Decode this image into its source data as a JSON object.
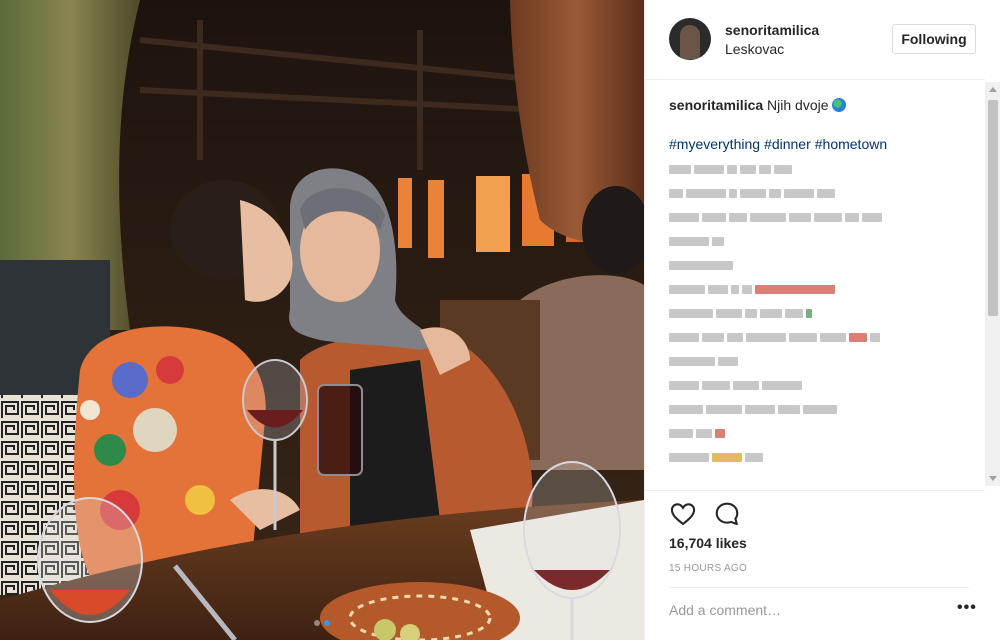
{
  "header": {
    "username": "senoritamilica",
    "location": "Leskovac",
    "follow_label": "Following"
  },
  "caption": {
    "username": "senoritamilica",
    "text": "Njih dvoje",
    "hashtags": [
      "#myeverything",
      "#dinner",
      "#hometown"
    ]
  },
  "blurred_comment_lines": [
    [
      22,
      30,
      10,
      16,
      12,
      18
    ],
    [
      14,
      40,
      8,
      26,
      12,
      30,
      18
    ],
    [
      30,
      24,
      18,
      36,
      22,
      28,
      14,
      20
    ],
    [
      40,
      12
    ],
    [
      64
    ],
    [
      36,
      20,
      8,
      10,
      80
    ],
    [
      44,
      26,
      12,
      22,
      18,
      6
    ],
    [
      30,
      22,
      16,
      40,
      28,
      26,
      18,
      10
    ],
    [
      46,
      20
    ],
    [
      30,
      28,
      26,
      40
    ],
    [
      34,
      36,
      30,
      22,
      34
    ],
    [
      24,
      16,
      10
    ],
    [
      40,
      30,
      18
    ]
  ],
  "actions": {
    "likes": "16,704 likes",
    "time": "15 HOURS AGO"
  },
  "comment_box": {
    "placeholder": "Add a comment…",
    "more": "•••"
  },
  "colors": {
    "link": "#003569",
    "carousel_active": "#3897f0",
    "text": "#262626",
    "muted": "#999999"
  },
  "icons": {
    "like": "heart-outline-icon",
    "comment": "speech-bubble-icon",
    "more": "ellipsis-icon"
  },
  "carousel": {
    "count": 2,
    "active": 1
  }
}
